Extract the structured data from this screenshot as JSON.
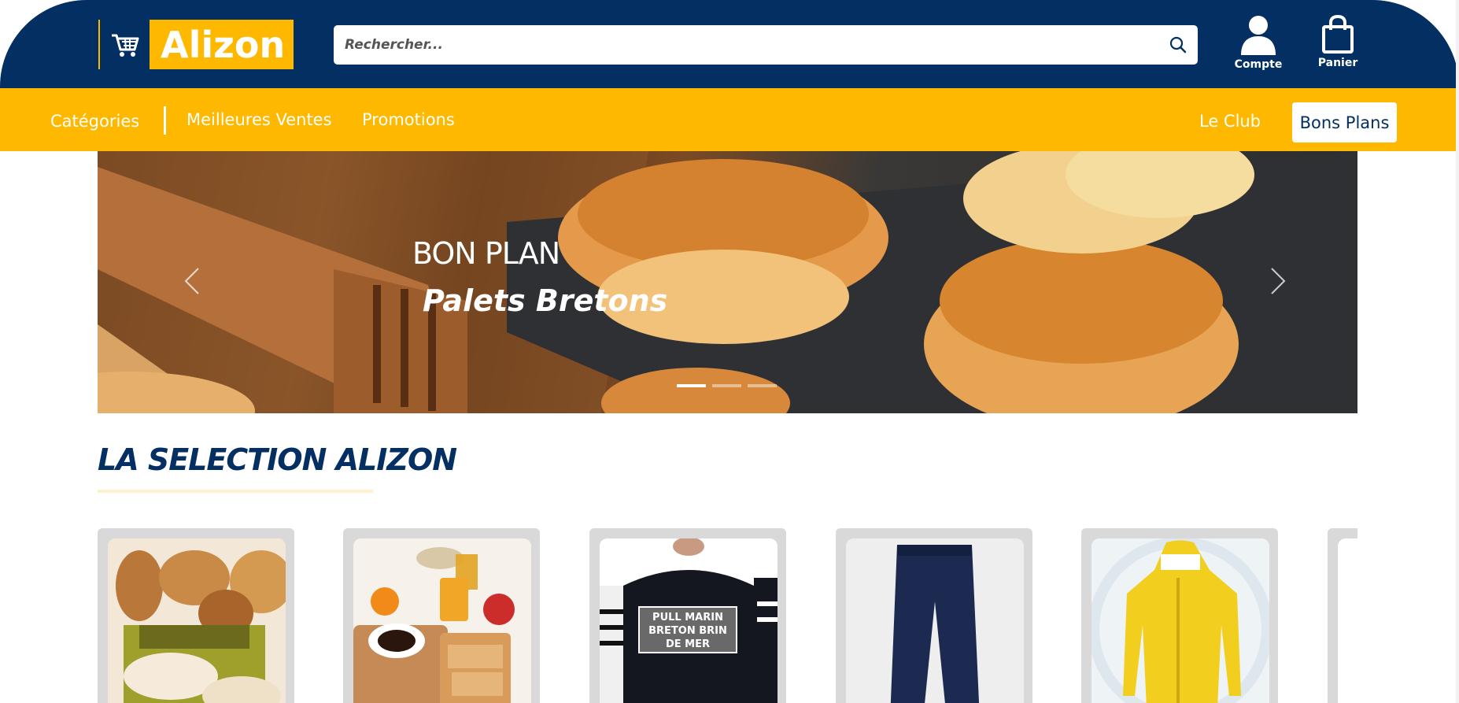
{
  "header": {
    "logo_text": "Alizon",
    "search_placeholder": "Rechercher...",
    "account_label": "Compte",
    "cart_label": "Panier",
    "brand_blue": "#032f62",
    "brand_yellow": "#ffb800"
  },
  "nav": {
    "categories": "Catégories",
    "best_sellers": "Meilleures Ventes",
    "promotions": "Promotions",
    "club": "Le Club",
    "bons_plans": "Bons Plans"
  },
  "carousel": {
    "kicker": "BON PLAN",
    "title": "Palets Bretons",
    "active_slide": 1,
    "slide_count": 3
  },
  "selection": {
    "title": "LA SELECTION ALIZON",
    "products": [
      {
        "image": "biscuits-box"
      },
      {
        "image": "breakfast-table"
      },
      {
        "image": "pull-marin",
        "label": "PULL MARIN BRETON BRIN DE MER"
      },
      {
        "image": "navy-pants"
      },
      {
        "image": "yellow-raincoat"
      },
      {
        "image": "partial-card"
      }
    ]
  }
}
